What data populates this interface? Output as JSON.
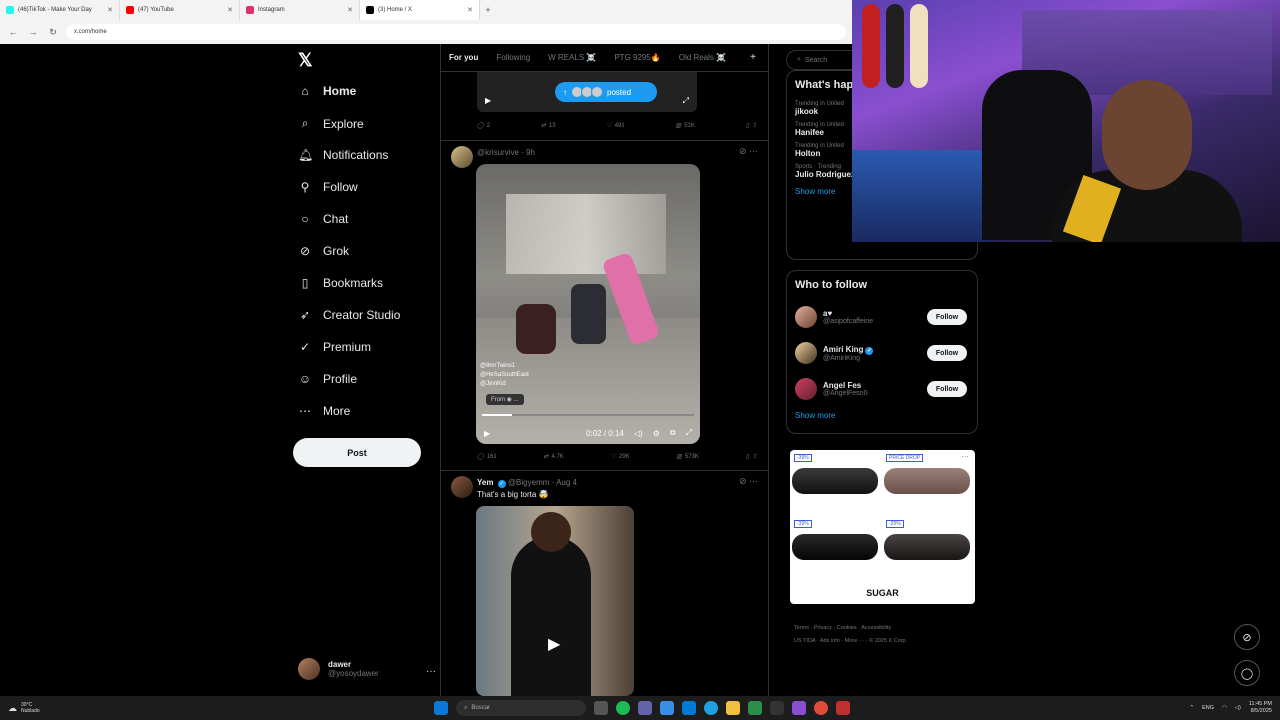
{
  "browser": {
    "tabs": [
      {
        "label": "(46)TikTok - Make Your Day",
        "color": "#25f4ee"
      },
      {
        "label": "(47) YouTube",
        "color": "#ff0000"
      },
      {
        "label": "Instagram",
        "color": "#e1306c"
      },
      {
        "label": "(3) Home / X",
        "color": "#000000"
      }
    ],
    "url": "x.com/home"
  },
  "left_nav": {
    "items": [
      {
        "label": "Home",
        "icon": "home-icon"
      },
      {
        "label": "Explore",
        "icon": "search-icon"
      },
      {
        "label": "Notifications",
        "icon": "bell-icon"
      },
      {
        "label": "Follow",
        "icon": "person-plus-icon"
      },
      {
        "label": "Chat",
        "icon": "chat-icon"
      },
      {
        "label": "Grok",
        "icon": "grok-icon"
      },
      {
        "label": "Bookmarks",
        "icon": "bookmark-icon"
      },
      {
        "label": "Creator Studio",
        "icon": "rocket-icon"
      },
      {
        "label": "Premium",
        "icon": "check-circle-icon"
      },
      {
        "label": "Profile",
        "icon": "person-icon"
      },
      {
        "label": "More",
        "icon": "more-circle-icon"
      }
    ],
    "post_label": "Post",
    "profile": {
      "name": "dawer",
      "handle": "@yosoydawer"
    }
  },
  "timeline": {
    "tabs": [
      "For you",
      "Following",
      "W REALS ☠️",
      "PTG 9295🔥",
      "Old Reals ☠️"
    ],
    "posted_label": "posted",
    "tweet1_actions": {
      "replies": "2",
      "reposts": "13",
      "likes": "491",
      "views": "51K"
    },
    "tweet2": {
      "handle": "@krisurvive · 9h",
      "watermark": [
        "@8mrTwins1",
        "@HeSaSouthEast",
        "@JinnKid"
      ],
      "from_label": "From",
      "time": "0:02 / 0:14",
      "progress": 0.14,
      "actions": {
        "replies": "161",
        "reposts": "4.7K",
        "likes": "29K",
        "views": "573K"
      }
    },
    "tweet3": {
      "name": "Yem",
      "handle": "@Bigyemm · Aug 4",
      "text": "That's a big torta 🤯"
    }
  },
  "right_col": {
    "search_placeholder": "Search",
    "trends_title": "What's hap",
    "trends": [
      {
        "category": "Trending in United",
        "name": "jikook"
      },
      {
        "category": "Trending in United",
        "name": "Hanifee"
      },
      {
        "category": "Trending in United",
        "name": "Holton"
      },
      {
        "category": "Sports · Trending",
        "name": "Julio Rodriguez"
      }
    ],
    "show_more": "Show more",
    "wtf_title": "Who to follow",
    "wtf": [
      {
        "name": "a♥",
        "handle": "@asipofcaffeine",
        "verified": false
      },
      {
        "name": "Amiri King",
        "handle": "@AmiriKing",
        "verified": true
      },
      {
        "name": "Angel Fes",
        "handle": "@AngelFesn0",
        "verified": false
      }
    ],
    "follow_label": "Follow",
    "ad": {
      "badges": [
        "-39%",
        "PRICE DROP",
        "-39%",
        "-35%"
      ],
      "brand": "SUGAR"
    },
    "footer": [
      "Terms",
      "Privacy",
      "Cookies",
      "Accessibility",
      "US TIDA",
      "Ads info",
      "More ···",
      "© 2025 X Corp."
    ]
  },
  "taskbar": {
    "weather_temp": "30°C",
    "weather_desc": "Nublado",
    "search": "Buscar",
    "lang": "ENG",
    "time": "11:45 PM",
    "date": "8/5/2025"
  }
}
